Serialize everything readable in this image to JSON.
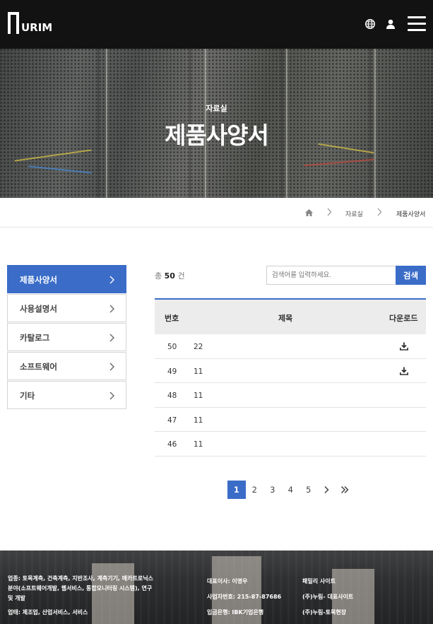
{
  "header": {
    "logo_text": "URIM",
    "icons": [
      "globe-icon",
      "user-icon",
      "hamburger-menu-icon"
    ]
  },
  "hero": {
    "subtitle": "자료실",
    "title": "제품사양서"
  },
  "breadcrumb": {
    "items": [
      "자료실",
      "제품사양서"
    ]
  },
  "sidebar": {
    "items": [
      {
        "label": "제품사양서",
        "active": true
      },
      {
        "label": "사용설명서"
      },
      {
        "label": "카탈로그"
      },
      {
        "label": "소프트웨어"
      },
      {
        "label": "기타"
      }
    ]
  },
  "list": {
    "total_prefix": "총",
    "total_count": "50",
    "total_suffix": "건",
    "search_placeholder": "검색어를 입력하세요.",
    "search_button": "검색",
    "columns": [
      "번호",
      "제목",
      "다운로드"
    ],
    "rows": [
      {
        "num": "50",
        "title": "22",
        "download": true
      },
      {
        "num": "49",
        "title": "11",
        "download": true
      },
      {
        "num": "48",
        "title": "11",
        "download": false
      },
      {
        "num": "47",
        "title": "11",
        "download": false
      },
      {
        "num": "46",
        "title": "11",
        "download": false
      }
    ]
  },
  "pagination": {
    "pages": [
      "1",
      "2",
      "3",
      "4",
      "5"
    ],
    "current": "1",
    "next_icon": "chevron-right-icon",
    "last_icon": "double-chevron-right-icon"
  },
  "footer": {
    "business_lines": [
      "업종: 토목계측, 건축계측, 지반조사, 계측기기, 메카트로닉스",
      "분야(소프트웨어개발, 웹서비스, 통합모니터링 시스템), 연구",
      "및 개발",
      "업태: 제조업, 산업서비스, 서비스"
    ],
    "company_lines": [
      "대표이사: 이명우",
      "사업자번호: 215-87-87686",
      "입금은행: IBK기업은행"
    ],
    "family_title": "패밀리 사이트",
    "family_links": [
      "(주)누림- 대표사이트",
      "(주)누림-토목현장"
    ]
  },
  "colors": {
    "accent": "#3a6cc8",
    "header_bg": "#121212"
  }
}
